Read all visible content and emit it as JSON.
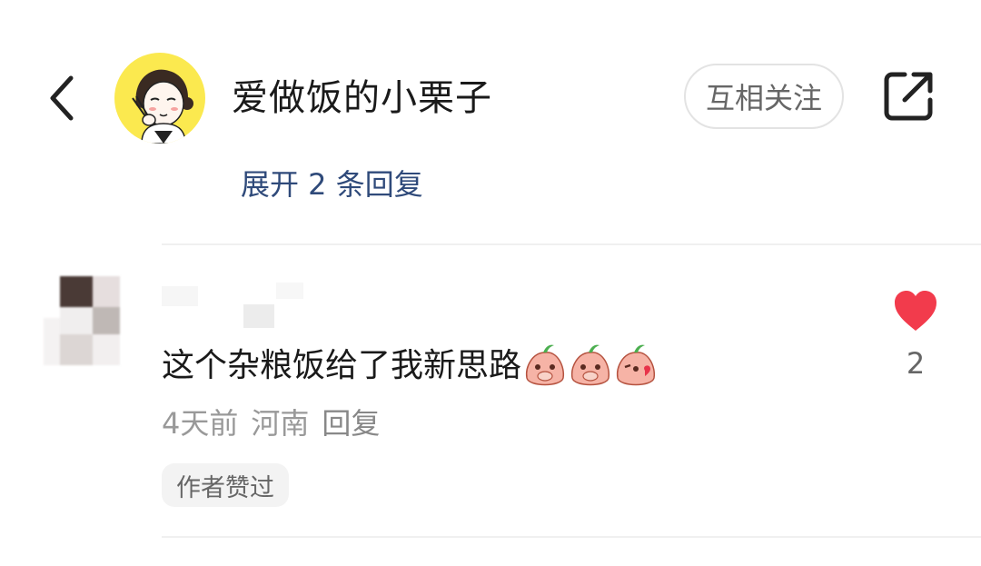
{
  "header": {
    "author_name": "爱做饭的小栗子",
    "follow_label": "互相关注"
  },
  "thread": {
    "expand_label": "展开 2 条回复"
  },
  "comment": {
    "text": "这个杂粮饭给了我新思路",
    "emojis": [
      "peach-cover-mouth-emoji",
      "peach-cover-mouth-emoji",
      "peach-kiss-emoji"
    ],
    "time": "4天前",
    "location": "河南",
    "reply_label": "回复",
    "badge": "作者赞过",
    "like_count": "2"
  },
  "colors": {
    "heart": "#f23b4c",
    "link": "#2f4a7a",
    "avatar_bg": "#fbe94f"
  }
}
